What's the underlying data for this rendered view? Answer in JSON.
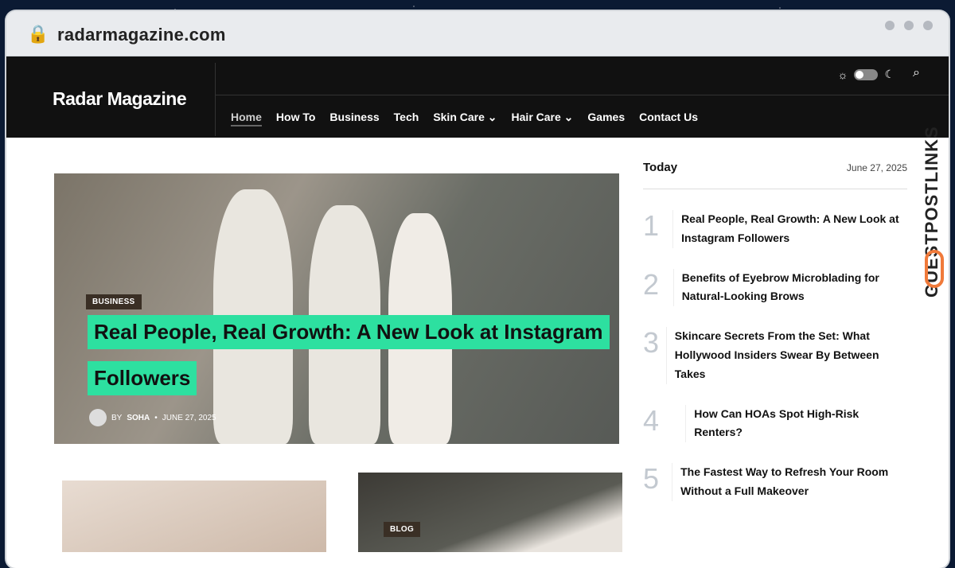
{
  "browser": {
    "url": "radarmagazine.com"
  },
  "site": {
    "logo": "Radar Magazine",
    "nav": [
      "Home",
      "How To",
      "Business",
      "Tech",
      "Skin Care ⌄",
      "Hair Care ⌄",
      "Games",
      "Contact Us"
    ]
  },
  "hero": {
    "badge": "BUSINESS",
    "title_line1": "Real People, Real Growth: A New Look at Instagram",
    "title_line2": "Followers",
    "by": "BY",
    "author": "SOHA",
    "date": "JUNE 27, 2025"
  },
  "cards": [
    {
      "badge": ""
    },
    {
      "badge": "BLOG"
    }
  ],
  "sidebar": {
    "heading": "Today",
    "date": "June 27, 2025",
    "items": [
      {
        "num": "1",
        "title": "Real People, Real Growth: A New Look at Instagram Followers"
      },
      {
        "num": "2",
        "title": "Benefits of Eyebrow Microblading for Natural-Looking Brows"
      },
      {
        "num": "3",
        "title": "Skincare Secrets From the Set: What Hollywood Insiders Swear By Between Takes"
      },
      {
        "num": "4",
        "title": "How Can HOAs Spot High-Risk Renters?"
      },
      {
        "num": "5",
        "title": "The Fastest Way to Refresh Your Room Without a Full Makeover"
      }
    ]
  },
  "watermark": "GUESTPOSTLINKS"
}
